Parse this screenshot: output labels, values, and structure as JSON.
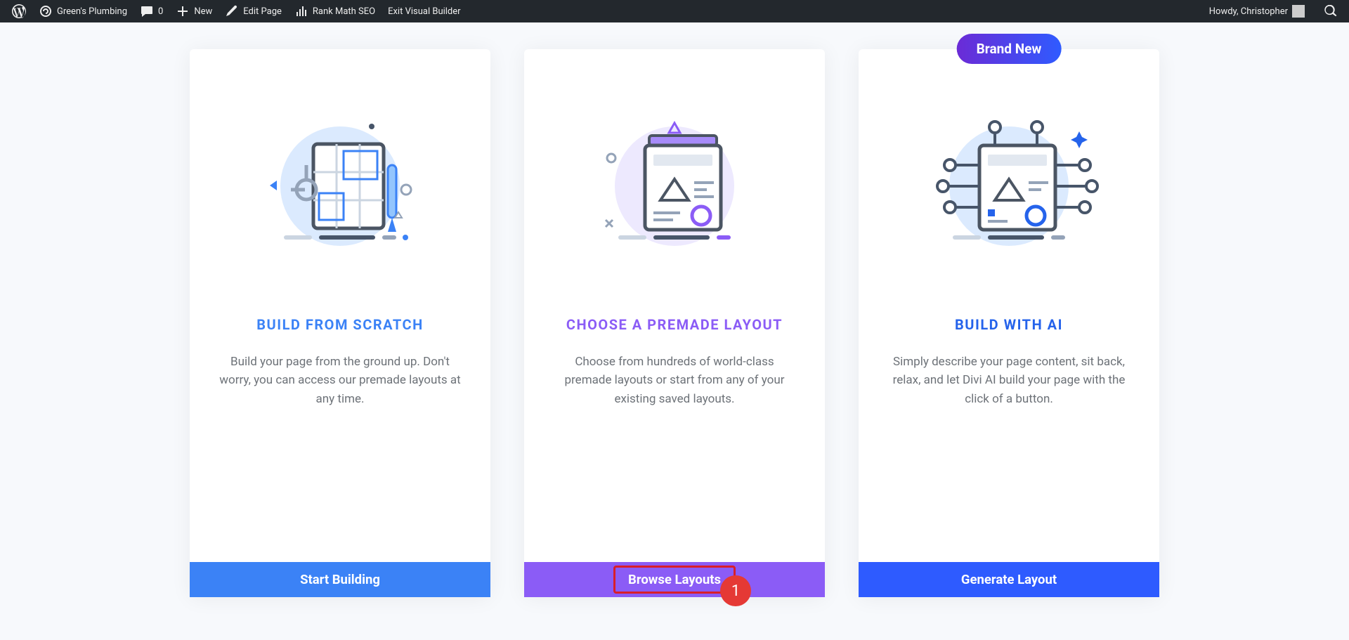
{
  "admin_bar": {
    "site_name": "Green's Plumbing",
    "comments": "0",
    "new": "New",
    "edit_page": "Edit Page",
    "rank_math": "Rank Math SEO",
    "exit_vb": "Exit Visual Builder",
    "howdy": "Howdy, Christopher"
  },
  "cards": {
    "scratch": {
      "title": "BUILD FROM SCRATCH",
      "desc": "Build your page from the ground up. Don't worry, you can access our premade layouts at any time.",
      "button": "Start Building"
    },
    "premade": {
      "title": "CHOOSE A PREMADE LAYOUT",
      "desc": "Choose from hundreds of world-class premade layouts or start from any of your existing saved layouts.",
      "button": "Browse Layouts"
    },
    "ai": {
      "badge": "Brand New",
      "title": "BUILD WITH AI",
      "desc": "Simply describe your page content, sit back, relax, and let Divi AI build your page with the click of a button.",
      "button": "Generate Layout"
    }
  },
  "annotation": {
    "label": "1"
  }
}
